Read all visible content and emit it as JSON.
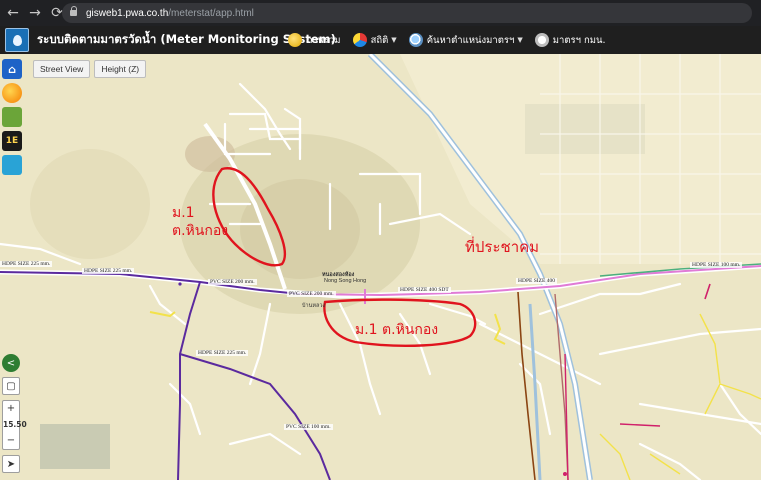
{
  "browser": {
    "url_host": "gisweb1.pwa.co.th",
    "url_path": "/meterstat/app.html"
  },
  "app": {
    "title": "ระบบติดตามมาตรวัดน้ำ (Meter Monitoring System)",
    "menu": [
      {
        "label": "ภาพรวม",
        "icon": "overview-icon",
        "dropdown": false
      },
      {
        "label": "สถิติ",
        "icon": "statistics-icon",
        "dropdown": true
      },
      {
        "label": "ค้นหาตำแหน่งมาตรฯ",
        "icon": "search-location-icon",
        "dropdown": true
      },
      {
        "label": "มาตรฯ กมน.",
        "icon": "meter-icon",
        "dropdown": false
      }
    ]
  },
  "map_controls": {
    "street_view": "Street View",
    "height": "Height (Z)",
    "zoom_in": "+",
    "zoom_level": "15.50",
    "zoom_out": "−"
  },
  "annotations": {
    "area1_line1": "ม.1",
    "area1_line2": "ต.หินกอง",
    "area2": "ม.1 ต.หินกอง",
    "community": "ที่ประชาคม"
  },
  "pipe_labels": {
    "hdpe_225_left": "HDPE SIZE 225 mm.",
    "hdpe_225_a": "HDPE SIZE 225 mm.",
    "pvc_200_a": "PVC SIZE 200 mm.",
    "pvc_200_b": "PVC SIZE 200 mm.",
    "hdpe_400_a": "HDPE SIZE 400 SDT",
    "hdpe_400_b": "HDPE SIZE 400",
    "hdpe_100_right": "HDPE SIZE 100 mm.",
    "hdpe_225_down": "HDPE SIZE 225 mm.",
    "pvc_100_down": "PVC SIZE 100 mm."
  },
  "place_labels": {
    "village": "หนองสองห้อง",
    "village_en": "Nong Song Hong",
    "village2": "บ้านหลวง"
  },
  "colors": {
    "annotation_red": "#e0141e",
    "pipe_purple": "#5b2a9e",
    "pipe_pink": "#e07bd6",
    "pipe_brown": "#8b4513",
    "pipe_yellow": "#f3e24a"
  }
}
